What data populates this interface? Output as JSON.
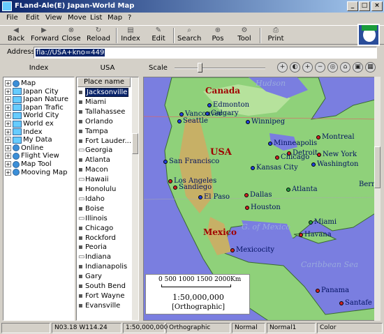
{
  "window": {
    "title": "FLand-Ale(E)  Japan-World Map"
  },
  "menu": [
    "File",
    "Edit",
    "View",
    "Move",
    "List",
    "Map",
    "?"
  ],
  "toolbar": {
    "back": "Back",
    "forward": "Forward",
    "close": "Close",
    "reload": "Reload",
    "index": "Index",
    "edit": "Edit",
    "search": "Search",
    "pos": "Pos",
    "tool": "Tool",
    "print": "Print"
  },
  "address": {
    "label": "Address",
    "value": "fla://USA+kno=449"
  },
  "panes": {
    "index_title": "Index",
    "list_title": "USA",
    "scale_label": "Scale"
  },
  "tree": [
    {
      "label": "Map",
      "icon": "globe-icon"
    },
    {
      "label": "Japan City",
      "icon": "folder-icon"
    },
    {
      "label": "Japan Nature",
      "icon": "folder-icon"
    },
    {
      "label": "Japan Trafic",
      "icon": "folder-icon"
    },
    {
      "label": "World City",
      "icon": "folder-icon"
    },
    {
      "label": "World ex",
      "icon": "folder-icon"
    },
    {
      "label": "Index",
      "icon": "folder-icon"
    },
    {
      "label": "My Data",
      "icon": "folder-icon"
    },
    {
      "label": "Online",
      "icon": "globe-icon"
    },
    {
      "label": "Flight View",
      "icon": "globe-icon"
    },
    {
      "label": "Map Tool",
      "icon": "globe-icon"
    },
    {
      "label": "Mooving Map",
      "icon": "globe-icon"
    }
  ],
  "place_list": {
    "header": "Place name",
    "items": [
      {
        "label": "Jacksonville",
        "kind": "bookmark",
        "selected": true
      },
      {
        "label": "Miami",
        "kind": "bookmark"
      },
      {
        "label": "Tallahassee",
        "kind": "bookmark"
      },
      {
        "label": "Orlando",
        "kind": "bookmark"
      },
      {
        "label": "Tampa",
        "kind": "bookmark"
      },
      {
        "label": "Fort Lauder...",
        "kind": "bookmark"
      },
      {
        "label": "Georgia",
        "kind": "group"
      },
      {
        "label": "Atlanta",
        "kind": "bookmark"
      },
      {
        "label": "Macon",
        "kind": "bookmark"
      },
      {
        "label": "Hawaii",
        "kind": "group"
      },
      {
        "label": "Honolulu",
        "kind": "bookmark"
      },
      {
        "label": "Idaho",
        "kind": "group"
      },
      {
        "label": "Boise",
        "kind": "bookmark"
      },
      {
        "label": "Illinois",
        "kind": "group"
      },
      {
        "label": "Chicago",
        "kind": "bookmark"
      },
      {
        "label": "Rockford",
        "kind": "bookmark"
      },
      {
        "label": "Peoria",
        "kind": "bookmark"
      },
      {
        "label": "Indiana",
        "kind": "group"
      },
      {
        "label": "Indianapolis",
        "kind": "bookmark"
      },
      {
        "label": "Gary",
        "kind": "bookmark"
      },
      {
        "label": "South Bend",
        "kind": "bookmark"
      },
      {
        "label": "Fort Wayne",
        "kind": "bookmark"
      },
      {
        "label": "Evansville",
        "kind": "bookmark"
      }
    ]
  },
  "map": {
    "regions": [
      "Canada",
      "USA",
      "Mexico"
    ],
    "seas": [
      "Hudson",
      "G. of Mexico",
      "Caribbean Sea"
    ],
    "cities": [
      {
        "name": "Edmonton",
        "color": "blue"
      },
      {
        "name": "Vancouver",
        "color": "blue"
      },
      {
        "name": "Calgary",
        "color": "blue"
      },
      {
        "name": "Seattle",
        "color": "blue"
      },
      {
        "name": "Winnipeg",
        "color": "blue"
      },
      {
        "name": "Montreal",
        "color": "red"
      },
      {
        "name": "Minneapolis",
        "color": "blue"
      },
      {
        "name": "Detroit",
        "color": "red"
      },
      {
        "name": "Chicago",
        "color": "red"
      },
      {
        "name": "New York",
        "color": "red"
      },
      {
        "name": "Washington",
        "color": "blue"
      },
      {
        "name": "San Francisco",
        "color": "blue"
      },
      {
        "name": "Kansas City",
        "color": "blue"
      },
      {
        "name": "Los Angeles",
        "color": "red"
      },
      {
        "name": "Sandiego",
        "color": "red"
      },
      {
        "name": "Atlanta",
        "color": "green"
      },
      {
        "name": "El Paso",
        "color": "blue"
      },
      {
        "name": "Dallas",
        "color": "red"
      },
      {
        "name": "Houston",
        "color": "red"
      },
      {
        "name": "Miami",
        "color": "green"
      },
      {
        "name": "Havana",
        "color": "red"
      },
      {
        "name": "Mexicocity",
        "color": "red"
      },
      {
        "name": "Panama",
        "color": "red"
      },
      {
        "name": "Santafe",
        "color": "red"
      },
      {
        "name": "Berr",
        "color": "none"
      }
    ],
    "legend": {
      "ticks": "0   500  1000  1500  2000Km",
      "ratio": "1:50,000,000",
      "projection": "[Orthographic]"
    }
  },
  "status": {
    "coords": "N03.18  W114.24",
    "scale": "1:50,000,000",
    "projection": "Orthographic",
    "mode1": "Normal",
    "mode2": "Normal1",
    "color": "Color"
  },
  "colors": {
    "titlebar_start": "#0a246a",
    "sea": "#7a7ee0",
    "land": "#8fd17a",
    "selection": "#0a246a"
  }
}
